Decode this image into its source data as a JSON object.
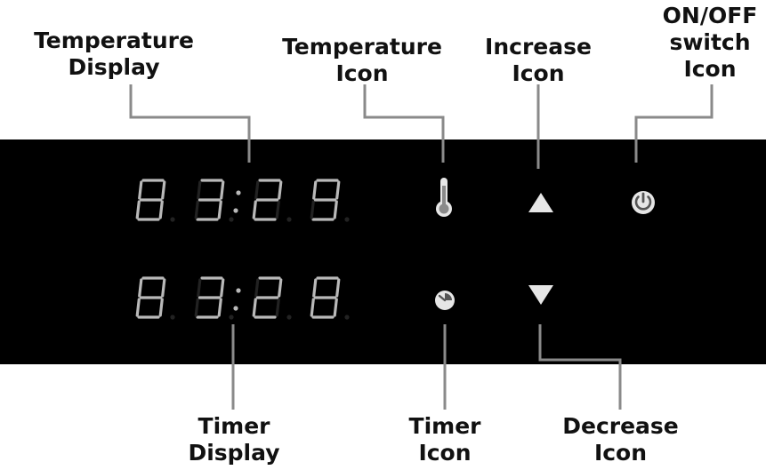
{
  "labels": {
    "temperature_display": [
      "Temperature",
      "Display"
    ],
    "temperature_icon": [
      "Temperature",
      "Icon"
    ],
    "increase_icon": [
      "Increase",
      "Icon"
    ],
    "onoff_icon": [
      "ON/OFF",
      "switch",
      "Icon"
    ],
    "timer_display": [
      "Timer",
      "Display"
    ],
    "timer_icon": [
      "Timer",
      "Icon"
    ],
    "decrease_icon": [
      "Decrease",
      "Icon"
    ]
  },
  "displays": {
    "temperature": "83:29",
    "timer": "83:28"
  },
  "icons": {
    "temperature": "thermometer-icon",
    "timer": "timer-icon",
    "increase": "triangle-up-icon",
    "decrease": "triangle-down-icon",
    "power": "power-icon"
  },
  "colors": {
    "panel": "#000000",
    "segment_on": "#b9b9b9",
    "segment_off": "#222222",
    "icon": "#e6e6e6",
    "leader_line": "#8a8a8a",
    "label_text": "#111111"
  }
}
